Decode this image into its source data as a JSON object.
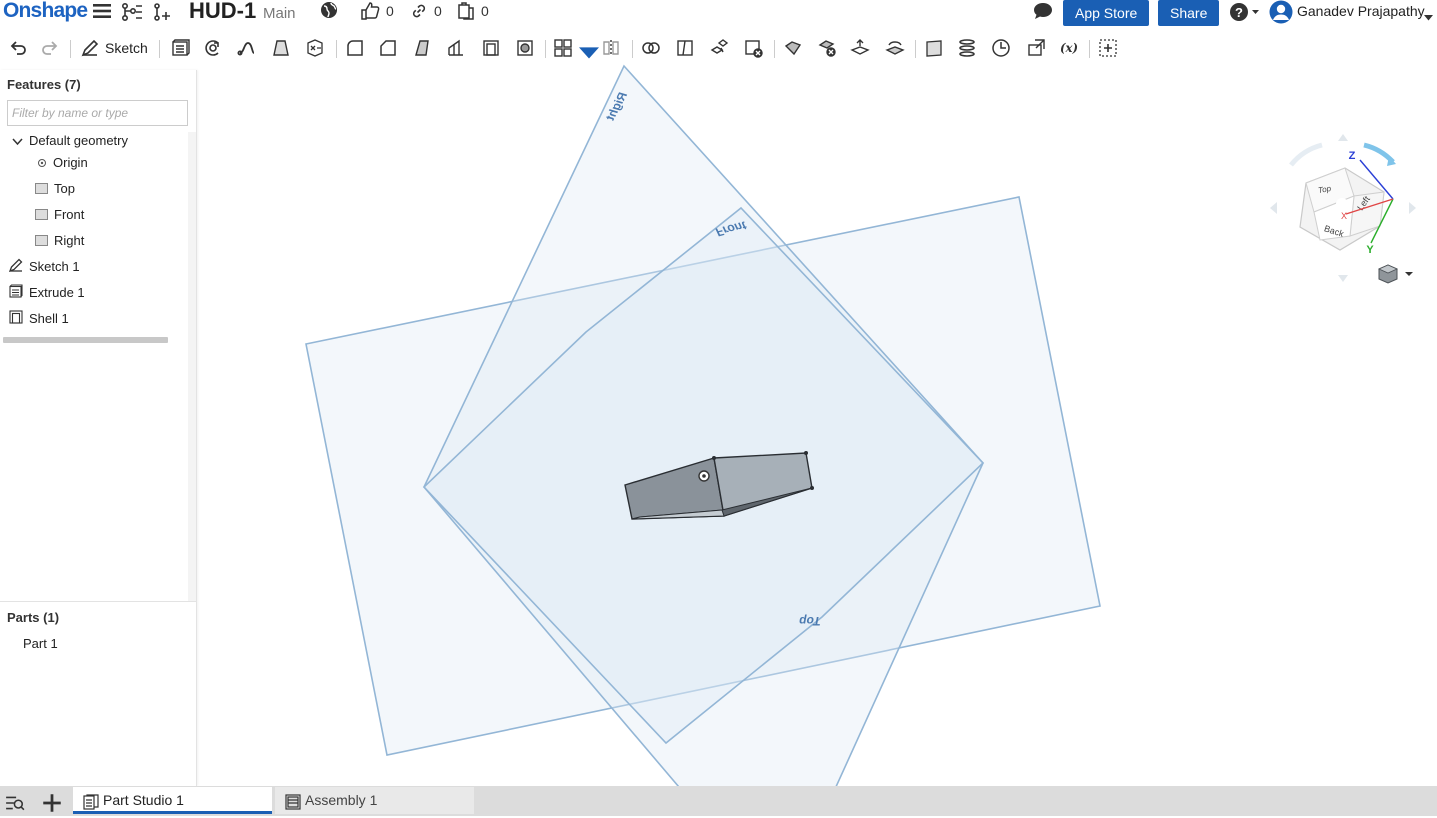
{
  "app": {
    "logo": "Onshape"
  },
  "document": {
    "title": "HUD-1",
    "branch": "Main"
  },
  "counters": {
    "likes": "0",
    "links": "0",
    "copies": "0"
  },
  "header": {
    "app_store_label": "App Store",
    "share_label": "Share",
    "user_name": "Ganadev Prajapathy"
  },
  "toolbar": {
    "sketch_label": "Sketch"
  },
  "features": {
    "title": "Features (7)",
    "filter_placeholder": "Filter by name or type",
    "items": [
      {
        "label": "Default geometry"
      },
      {
        "label": "Origin"
      },
      {
        "label": "Top"
      },
      {
        "label": "Front"
      },
      {
        "label": "Right"
      },
      {
        "label": "Sketch 1"
      },
      {
        "label": "Extrude 1"
      },
      {
        "label": "Shell 1"
      }
    ]
  },
  "parts": {
    "title": "Parts (1)",
    "items": [
      {
        "label": "Part 1"
      }
    ]
  },
  "viewport": {
    "plane_labels": {
      "top": "Top",
      "front": "Front",
      "right": "Right"
    },
    "view_cube": {
      "top": "Top",
      "left": "Left",
      "back": "Back",
      "axis_x": "X",
      "axis_y": "Y",
      "axis_z": "Z"
    }
  },
  "tabs": [
    {
      "label": "Part Studio 1"
    },
    {
      "label": "Assembly 1"
    }
  ],
  "colors": {
    "accent": "#1a5fb4",
    "plane_stroke": "#93b6d6",
    "plane_fill": "#dce9f4"
  }
}
